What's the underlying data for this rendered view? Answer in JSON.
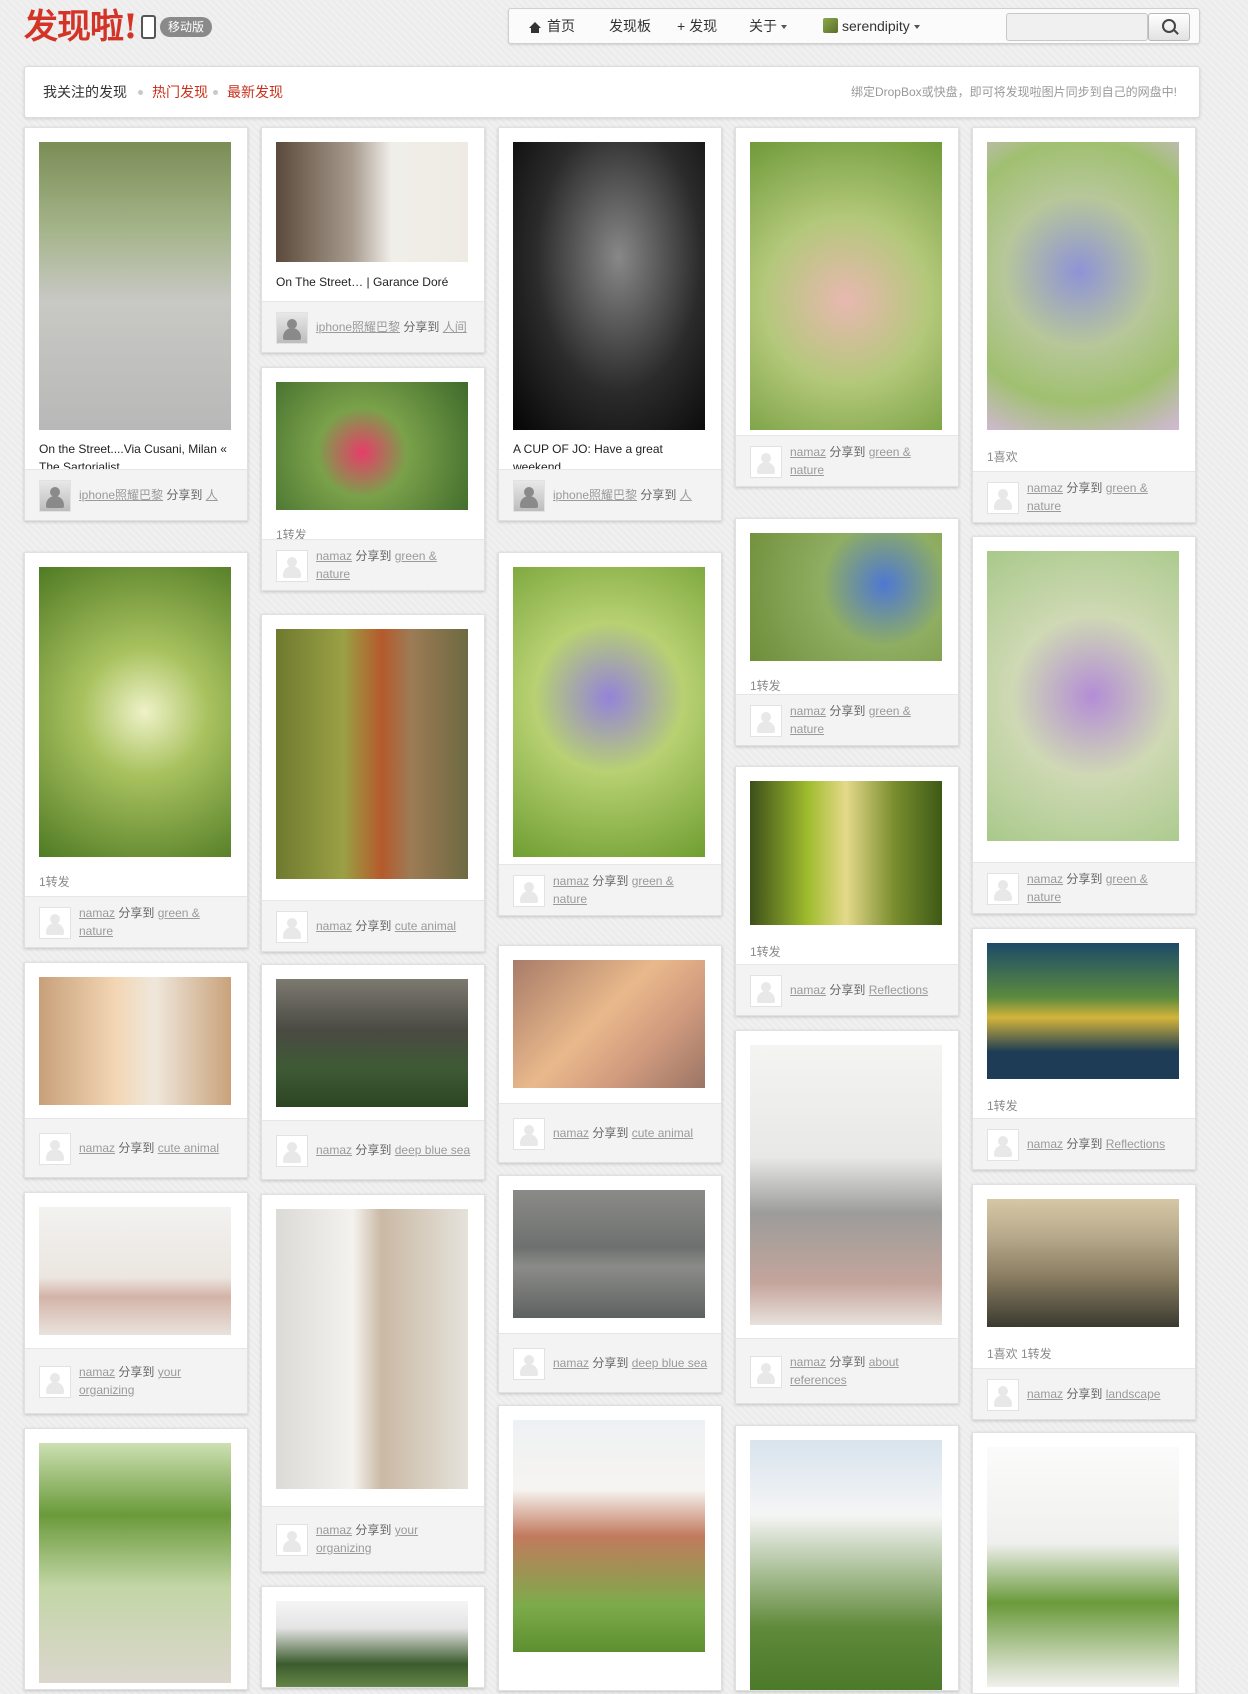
{
  "header": {
    "logo_text": "发现啦!",
    "mobile_label": "移动版",
    "nav": {
      "home": "首页",
      "boards": "发现板",
      "discover": "+ 发现",
      "about": "关于",
      "user": "serendipity"
    },
    "search": {
      "placeholder": ""
    }
  },
  "tabs": {
    "following": "我关注的发现",
    "popular": "热门发现",
    "latest": "最新发现",
    "notice": "绑定DropBox或快盘，即可将发现啦图片同步到自己的网盘中!"
  },
  "colors": {
    "brand": "#d33427",
    "tab_active": "#c8321e"
  },
  "pins": [
    {
      "desc": "On the Street....Via Cusani, Milan « The Sartorialist",
      "stats": "",
      "user": "iphone照耀巴黎",
      "shared": "分享到",
      "board": "人"
    },
    {
      "desc": "On The Street… | Garance Doré",
      "stats": "",
      "user": "iphone照耀巴黎",
      "shared": "分享到",
      "board": "人间"
    },
    {
      "desc": "A CUP OF JO: Have a great weekend.",
      "stats": "",
      "user": "iphone照耀巴黎",
      "shared": "分享到",
      "board": "人"
    },
    {
      "desc": "",
      "stats": "",
      "user": "namaz",
      "shared": "分享到",
      "board": "green & nature"
    },
    {
      "desc": "",
      "stats": "1喜欢",
      "user": "namaz",
      "shared": "分享到",
      "board": "green & nature"
    },
    {
      "desc": "",
      "stats": "1转发",
      "user": "namaz",
      "shared": "分享到",
      "board": "green & nature"
    },
    {
      "desc": "",
      "stats": "1转发",
      "user": "namaz",
      "shared": "分享到",
      "board": "green & nature"
    },
    {
      "desc": "",
      "stats": "",
      "user": "namaz",
      "shared": "分享到",
      "board": "green & nature"
    },
    {
      "desc": "",
      "stats": "1转发",
      "user": "namaz",
      "shared": "分享到",
      "board": "green & nature"
    },
    {
      "desc": "",
      "stats": "",
      "user": "namaz",
      "shared": "分享到",
      "board": "green & nature"
    },
    {
      "desc": "",
      "stats": "",
      "user": "namaz",
      "shared": "分享到",
      "board": "cute animal"
    },
    {
      "desc": "",
      "stats": "1转发",
      "user": "namaz",
      "shared": "分享到",
      "board": "Reflections"
    },
    {
      "desc": "",
      "stats": "1转发",
      "user": "namaz",
      "shared": "分享到",
      "board": "Reflections"
    },
    {
      "desc": "",
      "stats": "",
      "user": "namaz",
      "shared": "分享到",
      "board": "cute animal"
    },
    {
      "desc": "",
      "stats": "",
      "user": "namaz",
      "shared": "分享到",
      "board": "deep blue sea"
    },
    {
      "desc": "",
      "stats": "",
      "user": "namaz",
      "shared": "分享到",
      "board": "cute animal"
    },
    {
      "desc": "",
      "stats": "",
      "user": "namaz",
      "shared": "分享到",
      "board": "your organizing"
    },
    {
      "desc": "",
      "stats": "",
      "user": "namaz",
      "shared": "分享到",
      "board": "your organizing"
    },
    {
      "desc": "",
      "stats": "",
      "user": "namaz",
      "shared": "分享到",
      "board": "deep blue sea"
    },
    {
      "desc": "",
      "stats": "",
      "user": "namaz",
      "shared": "分享到",
      "board": "about references"
    },
    {
      "desc": "",
      "stats": "1喜欢 1转发",
      "user": "namaz",
      "shared": "分享到",
      "board": "landscape"
    }
  ]
}
